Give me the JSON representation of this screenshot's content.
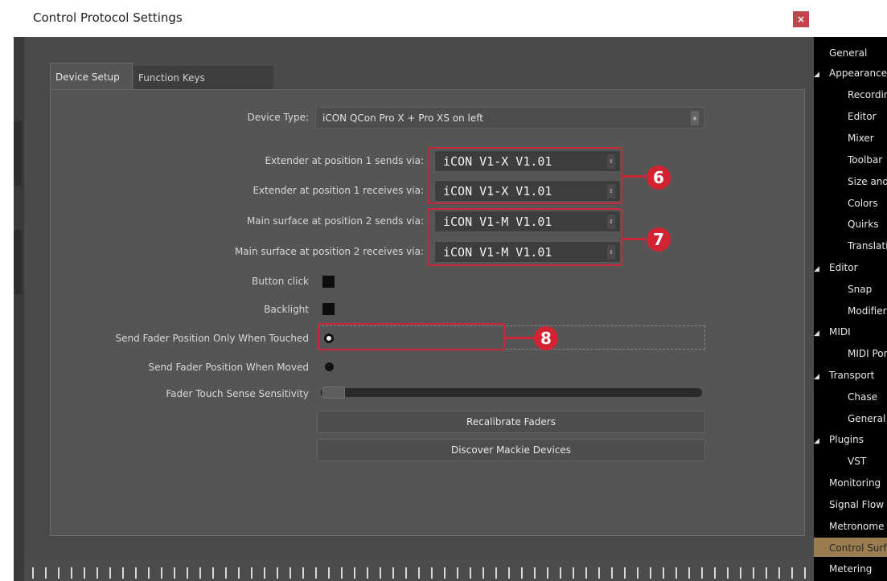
{
  "window": {
    "title": "Control Protocol Settings",
    "close_label": "×"
  },
  "tabs": [
    {
      "label": "Device Setup",
      "active": true
    },
    {
      "label": "Function Keys",
      "active": false
    }
  ],
  "device_type": {
    "label": "Device Type:",
    "value": "iCON QCon Pro X + Pro XS on left"
  },
  "midi_ports": [
    {
      "label": "Extender at position 1 sends via:",
      "value": "iCON V1-X V1.01"
    },
    {
      "label": "Extender at position 1 receives via:",
      "value": "iCON V1-X V1.01"
    },
    {
      "label": "Main surface at position 2 sends via:",
      "value": "iCON V1-M V1.01"
    },
    {
      "label": "Main surface at position 2 receives via:",
      "value": "iCON V1-M V1.01"
    }
  ],
  "options": {
    "button_click": {
      "label": "Button click",
      "checked": true
    },
    "backlight": {
      "label": "Backlight",
      "checked": true
    },
    "fader_touched": {
      "label": "Send Fader Position Only When Touched",
      "selected": true
    },
    "fader_moved": {
      "label": "Send Fader Position When Moved",
      "selected": false
    },
    "sensitivity": {
      "label": "Fader Touch Sense Sensitivity",
      "value": 0
    }
  },
  "buttons": {
    "recalibrate": "Recalibrate Faders",
    "discover": "Discover Mackie Devices"
  },
  "annotations": [
    "6",
    "7",
    "8"
  ],
  "annotation_color": "#d32232",
  "sidebar": {
    "selected_color": "#9a7c4e",
    "items": [
      "General",
      "Appearance",
      "Recording",
      "Editor",
      "Mixer",
      "Toolbar",
      "Size and",
      "Colors",
      "Quirks",
      "Translation",
      "Editor",
      "Snap",
      "Modifiers",
      "MIDI",
      "MIDI Ports",
      "Transport",
      "Chase",
      "General",
      "Plugins",
      "VST",
      "Monitoring",
      "Signal Flow",
      "Metronome",
      "Control Surfaces",
      "Metering"
    ]
  }
}
